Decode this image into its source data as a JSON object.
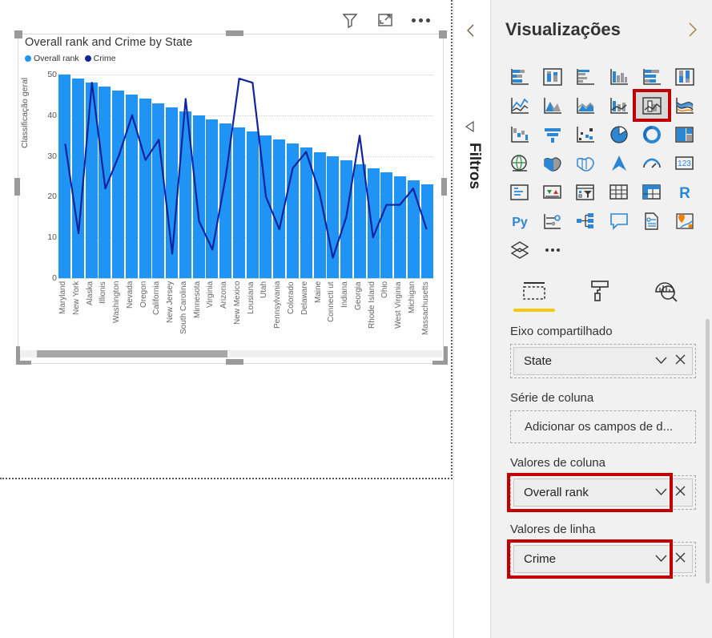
{
  "canvas": {
    "toolbar": [
      {
        "name": "filter-icon",
        "label": "Filtros"
      },
      {
        "name": "focus-mode-icon",
        "label": "Modo de foco"
      },
      {
        "name": "more-options-icon",
        "label": "Mais opções"
      }
    ]
  },
  "visual": {
    "title": "Overall rank and Crime by State",
    "legend": [
      {
        "label": "Overall rank",
        "color": "#1f94f5"
      },
      {
        "label": "Crime",
        "color": "#12239e"
      }
    ],
    "scrollbar": {
      "name": "horizontal-scrollbar"
    }
  },
  "chart_data": {
    "type": "bar",
    "title": "Overall rank and Crime by State",
    "xlabel": "State",
    "ylabel": "Classificação geral",
    "ylim": [
      0,
      50
    ],
    "yticks": [
      50,
      40,
      30,
      20,
      10,
      0
    ],
    "grid": true,
    "legend_position": "top-left",
    "categories": [
      "Maryland",
      "New York",
      "Alaska",
      "Illionis",
      "Washington",
      "Nevada",
      "Oregon",
      "California",
      "New Jersey",
      "South Carolina",
      "Minnesota",
      "Virginia",
      "Arizona",
      "New Mexico",
      "Lousiana",
      "Utah",
      "Pennsylvania",
      "Colorado",
      "Delaware",
      "Maine",
      "Connecti ut",
      "Indiana",
      "Georgia",
      "Rhode Island",
      "Ohio",
      "West Virginia",
      "Michigan",
      "Massachusetts"
    ],
    "series": [
      {
        "name": "Overall rank",
        "type": "bar",
        "color": "#1f94f5",
        "values": [
          50,
          49,
          48,
          47,
          46,
          45,
          44,
          43,
          42,
          41,
          40,
          39,
          38,
          37,
          36,
          35,
          34,
          33,
          32,
          31,
          30,
          29,
          28,
          27,
          26,
          25,
          24,
          23
        ]
      },
      {
        "name": "Crime",
        "type": "line",
        "color": "#12239e",
        "values": [
          33,
          11,
          48,
          22,
          30,
          40,
          29,
          34,
          6,
          44,
          14,
          7,
          25,
          49,
          48,
          20,
          12,
          27,
          31,
          21,
          5,
          15,
          35,
          10,
          18,
          18,
          22,
          12
        ]
      }
    ]
  },
  "filters_rail": {
    "title": "Filtros",
    "collapse_icon": "chevron-left-icon",
    "expand_icon": "play-left-icon"
  },
  "visualizations": {
    "title": "Visualizações",
    "expand_icon": "chevron-right-icon",
    "gallery": [
      "stacked-bar-chart-icon",
      "stacked-column-chart-icon",
      "clustered-bar-chart-icon",
      "clustered-column-chart-icon",
      "100-stacked-bar-chart-icon",
      "100-stacked-column-chart-icon",
      "line-chart-icon",
      "area-chart-icon",
      "stacked-area-chart-icon",
      "line-and-stacked-column-chart-icon",
      "line-and-clustered-column-chart-icon",
      "ribbon-chart-icon",
      "waterfall-chart-icon",
      "funnel-chart-icon",
      "scatter-chart-icon",
      "pie-chart-icon",
      "donut-chart-icon",
      "treemap-icon",
      "map-icon",
      "filled-map-icon",
      "shape-map-icon",
      "azure-map-icon",
      "gauge-icon",
      "card-icon",
      "multi-row-card-icon",
      "kpi-icon",
      "slicer-icon",
      "table-icon",
      "matrix-icon",
      "r-script-visual-icon",
      "python-visual-icon",
      "key-influencers-icon",
      "decomposition-tree-icon",
      "q-and-a-icon",
      "smart-narrative-icon",
      "arcgis-maps-icon",
      "paginated-report-icon",
      "more-visuals-icon"
    ],
    "selected_visual": "line-and-clustered-column-chart-icon",
    "tabs": [
      {
        "name": "fields-tab",
        "icon": "fields-icon",
        "active": true
      },
      {
        "name": "format-tab",
        "icon": "paint-roller-icon",
        "active": false
      },
      {
        "name": "analytics-tab",
        "icon": "analytics-magnifier-icon",
        "active": false
      }
    ],
    "wells": [
      {
        "label": "Eixo compartilhado",
        "name": "shared-axis-well",
        "highlighted": false,
        "field": {
          "value": "State",
          "filled": true
        }
      },
      {
        "label": "Série de coluna",
        "name": "column-series-well",
        "highlighted": false,
        "field": {
          "value": "Adicionar os campos de d...",
          "filled": false
        }
      },
      {
        "label": "Valores de coluna",
        "name": "column-values-well",
        "highlighted": true,
        "field": {
          "value": "Overall rank",
          "filled": true
        }
      },
      {
        "label": "Valores de linha",
        "name": "line-values-well",
        "highlighted": true,
        "field": {
          "value": "Crime",
          "filled": true
        }
      }
    ],
    "chip_icons": {
      "dropdown": "chevron-down-icon",
      "remove": "close-icon"
    }
  }
}
